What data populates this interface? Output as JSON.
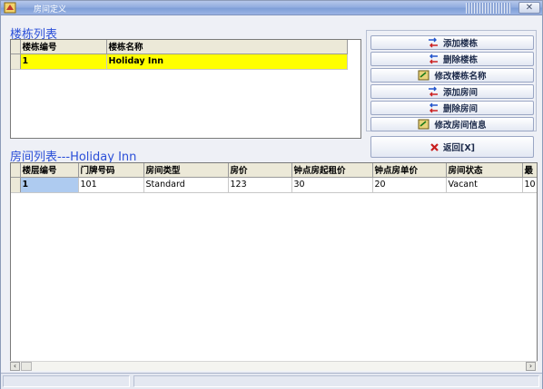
{
  "window": {
    "title": "房间定义"
  },
  "buildings": {
    "title": "楼栋列表",
    "columns": [
      "楼栋编号",
      "楼栋名称"
    ],
    "rows": [
      [
        "1",
        "Holiday Inn"
      ]
    ]
  },
  "buttons": {
    "add_building": "添加楼栋",
    "delete_building": "删除楼栋",
    "rename_building": "修改楼栋名称",
    "add_room": "添加房间",
    "delete_room": "删除房间",
    "edit_room": "修改房间信息",
    "return": "返回[X]"
  },
  "rooms": {
    "title": "房间列表---Holiday Inn",
    "columns": [
      "楼层编号",
      "门牌号码",
      "房间类型",
      "房价",
      "钟点房起租价",
      "钟点房单价",
      "房间状态",
      "最"
    ],
    "rows": [
      [
        "1",
        "101",
        "Standard",
        "123",
        "30",
        "20",
        "Vacant",
        "10"
      ]
    ]
  },
  "colors": {
    "accent": "#2b4fd8",
    "selection": "#ffff00",
    "cell_focus": "#aecbf0"
  },
  "icons": [
    "swap-arrows-icon",
    "delete-arrows-icon",
    "edit-icon",
    "close-x-icon"
  ]
}
